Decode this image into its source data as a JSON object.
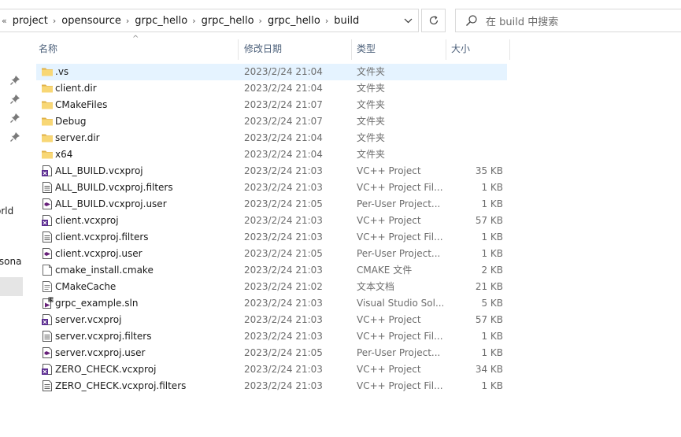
{
  "address_bar": {
    "breadcrumbs": [
      "project",
      "opensource",
      "grpc_hello",
      "grpc_hello",
      "grpc_hello",
      "build"
    ],
    "dropdown_icon": "chevron-down-icon"
  },
  "refresh_icon": "refresh-icon",
  "search": {
    "placeholder": "在 build 中搜索",
    "icon": "search-icon"
  },
  "nav_pane": {
    "partial_labels": [
      "orld",
      "rsona"
    ]
  },
  "columns": {
    "name": "名称",
    "date": "修改日期",
    "type": "类型",
    "size": "大小"
  },
  "files": [
    {
      "name": ".vs",
      "date": "2023/2/24 21:04",
      "type": "文件夹",
      "size": "",
      "icon": "folder"
    },
    {
      "name": "client.dir",
      "date": "2023/2/24 21:04",
      "type": "文件夹",
      "size": "",
      "icon": "folder"
    },
    {
      "name": "CMakeFiles",
      "date": "2023/2/24 21:07",
      "type": "文件夹",
      "size": "",
      "icon": "folder"
    },
    {
      "name": "Debug",
      "date": "2023/2/24 21:07",
      "type": "文件夹",
      "size": "",
      "icon": "folder"
    },
    {
      "name": "server.dir",
      "date": "2023/2/24 21:04",
      "type": "文件夹",
      "size": "",
      "icon": "folder"
    },
    {
      "name": "x64",
      "date": "2023/2/24 21:04",
      "type": "文件夹",
      "size": "",
      "icon": "folder"
    },
    {
      "name": "ALL_BUILD.vcxproj",
      "date": "2023/2/24 21:03",
      "type": "VC++ Project",
      "size": "35 KB",
      "icon": "vcxproj"
    },
    {
      "name": "ALL_BUILD.vcxproj.filters",
      "date": "2023/2/24 21:03",
      "type": "VC++ Project Fil...",
      "size": "1 KB",
      "icon": "filters"
    },
    {
      "name": "ALL_BUILD.vcxproj.user",
      "date": "2023/2/24 21:05",
      "type": "Per-User Project...",
      "size": "1 KB",
      "icon": "user"
    },
    {
      "name": "client.vcxproj",
      "date": "2023/2/24 21:03",
      "type": "VC++ Project",
      "size": "57 KB",
      "icon": "vcxproj"
    },
    {
      "name": "client.vcxproj.filters",
      "date": "2023/2/24 21:03",
      "type": "VC++ Project Fil...",
      "size": "1 KB",
      "icon": "filters"
    },
    {
      "name": "client.vcxproj.user",
      "date": "2023/2/24 21:05",
      "type": "Per-User Project...",
      "size": "1 KB",
      "icon": "user"
    },
    {
      "name": "cmake_install.cmake",
      "date": "2023/2/24 21:03",
      "type": "CMAKE 文件",
      "size": "2 KB",
      "icon": "blank"
    },
    {
      "name": "CMakeCache",
      "date": "2023/2/24 21:02",
      "type": "文本文档",
      "size": "21 KB",
      "icon": "text"
    },
    {
      "name": "grpc_example.sln",
      "date": "2023/2/24 21:03",
      "type": "Visual Studio Sol...",
      "size": "5 KB",
      "icon": "sln"
    },
    {
      "name": "server.vcxproj",
      "date": "2023/2/24 21:03",
      "type": "VC++ Project",
      "size": "57 KB",
      "icon": "vcxproj"
    },
    {
      "name": "server.vcxproj.filters",
      "date": "2023/2/24 21:03",
      "type": "VC++ Project Fil...",
      "size": "1 KB",
      "icon": "filters"
    },
    {
      "name": "server.vcxproj.user",
      "date": "2023/2/24 21:05",
      "type": "Per-User Project...",
      "size": "1 KB",
      "icon": "user"
    },
    {
      "name": "ZERO_CHECK.vcxproj",
      "date": "2023/2/24 21:03",
      "type": "VC++ Project",
      "size": "34 KB",
      "icon": "vcxproj"
    },
    {
      "name": "ZERO_CHECK.vcxproj.filters",
      "date": "2023/2/24 21:03",
      "type": "VC++ Project Fil...",
      "size": "1 KB",
      "icon": "filters"
    }
  ],
  "colors": {
    "folder": "#f8d775",
    "folder_dark": "#e0b24a",
    "selection": "#e5f3ff",
    "header_text": "#4c607a",
    "vs_purple": "#68217a"
  }
}
